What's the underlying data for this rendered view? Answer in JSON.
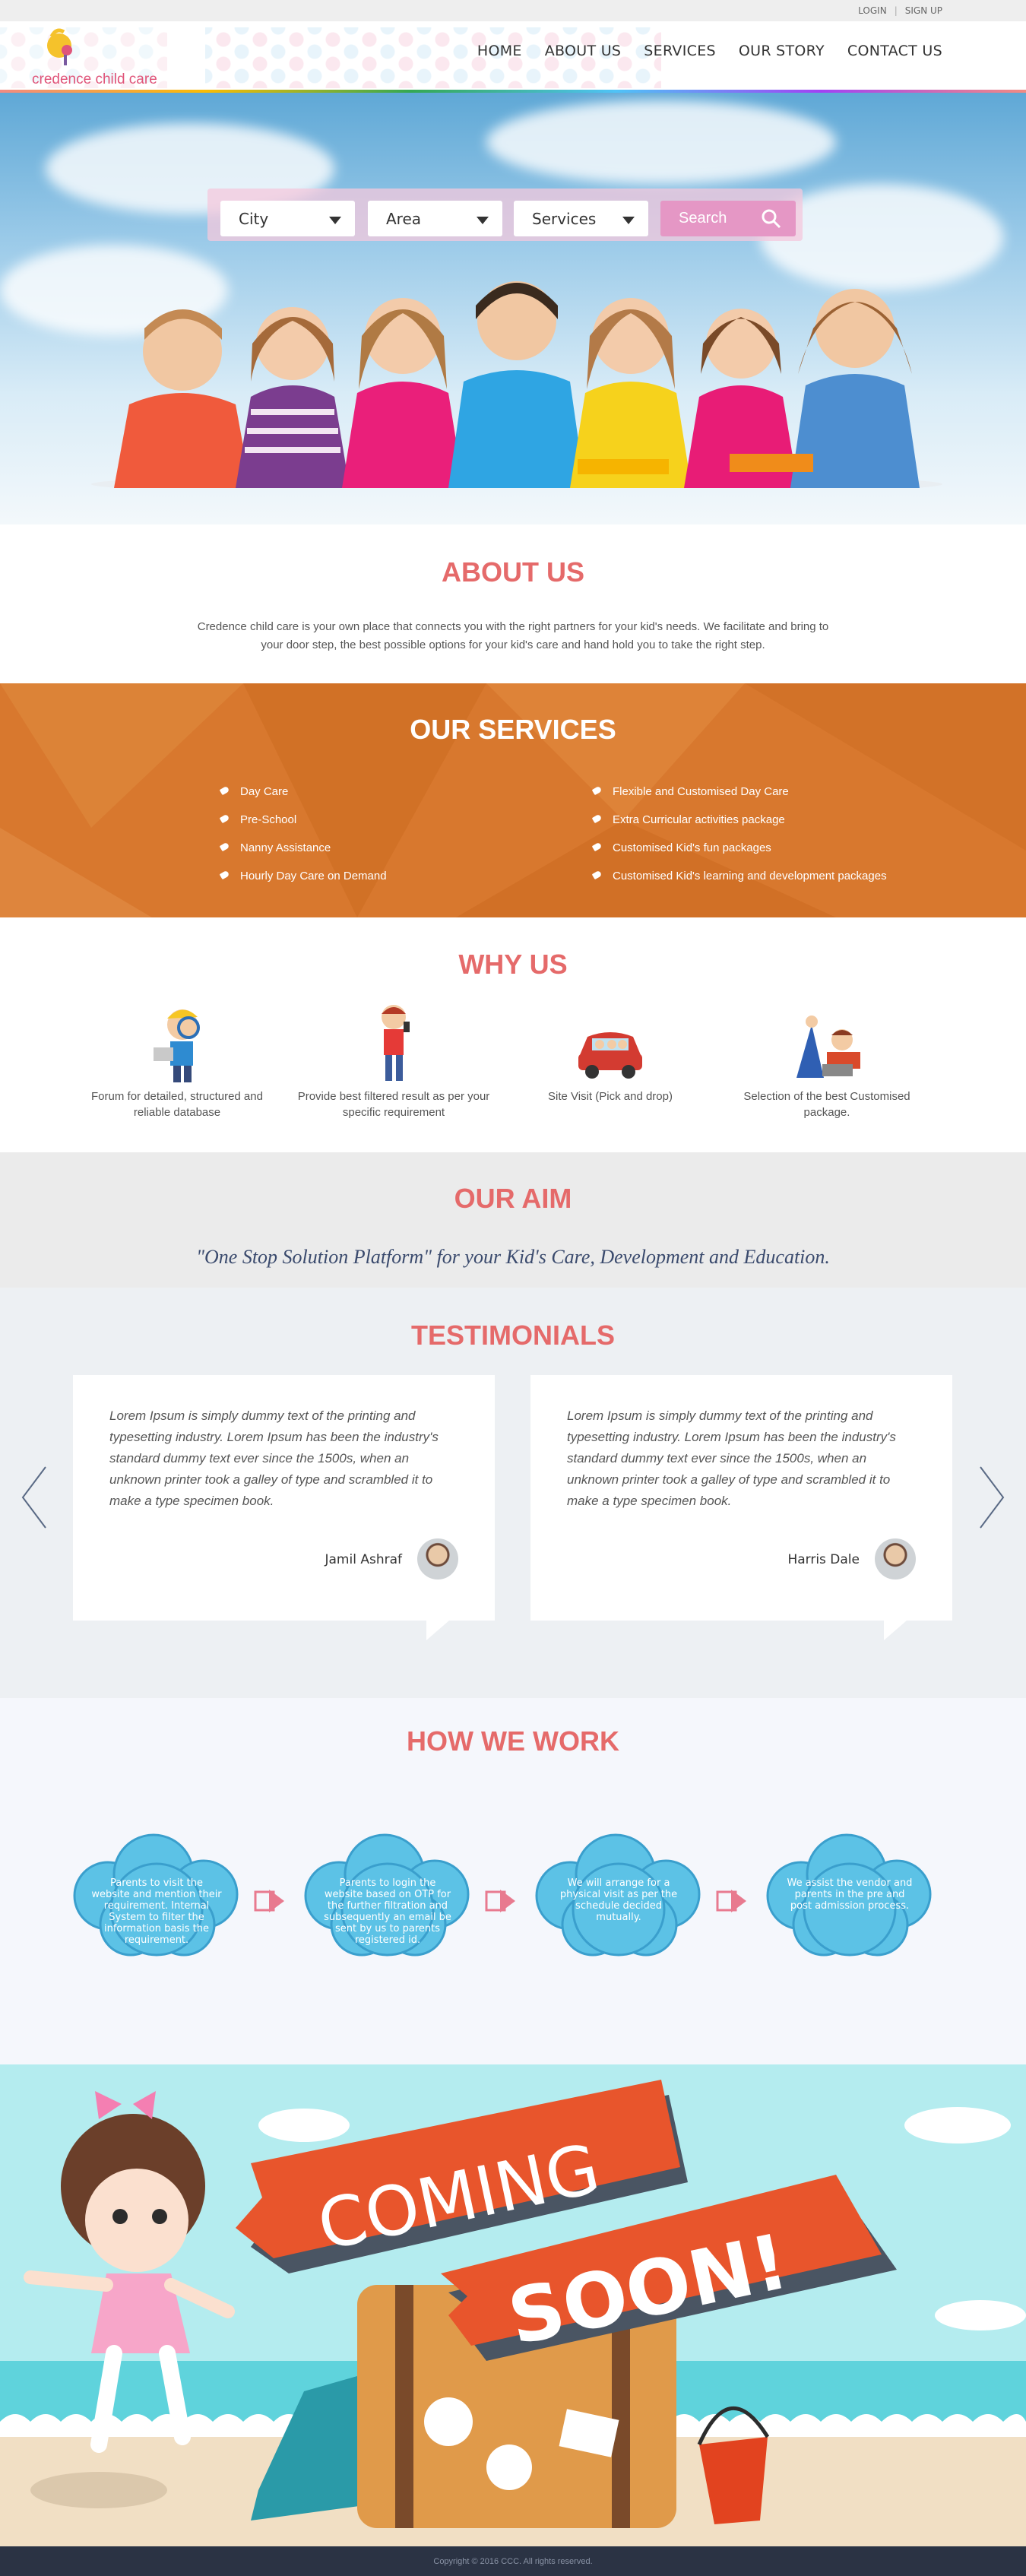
{
  "toplinks": {
    "login": "LOGIN",
    "signup": "SIGN UP"
  },
  "logo": {
    "text": "credence child care"
  },
  "nav": [
    "HOME",
    "ABOUT US",
    "SERVICES",
    "OUR STORY",
    "CONTACT US"
  ],
  "search": {
    "city": "City",
    "area": "Area",
    "services": "Services",
    "button": "Search"
  },
  "about": {
    "title": "ABOUT US",
    "text": "Credence child care is your own place that connects you with the right partners for your kid's needs. We facilitate and bring to your door step, the best possible options for your kid's care and hand hold you to take the right step."
  },
  "services": {
    "title": "OUR SERVICES",
    "left": [
      "Day Care",
      "Pre-School",
      "Nanny Assistance",
      "Hourly Day Care on Demand"
    ],
    "right": [
      "Flexible and Customised Day Care",
      "Extra Curricular activities package",
      "Customised Kid's fun packages",
      "Customised Kid's learning and development packages"
    ]
  },
  "why": {
    "title": "WHY US",
    "items": [
      "Forum for detailed, structured and reliable database",
      "Provide best filtered result as per your specific requirement",
      "Site Visit (Pick and drop)",
      "Selection of the best Customised package."
    ]
  },
  "aim": {
    "title": "OUR AIM",
    "quote": "\"One Stop Solution Platform\" for your Kid's Care, Development and Education."
  },
  "testimonials": {
    "title": "TESTIMONIALS",
    "items": [
      {
        "text": "Lorem Ipsum is simply dummy text of the printing and typesetting industry. Lorem Ipsum has been the industry's standard dummy text ever since the 1500s, when an unknown printer took a galley of type and scrambled it to make a type specimen book.",
        "name": "Jamil Ashraf"
      },
      {
        "text": "Lorem Ipsum is simply dummy text of the printing and typesetting industry. Lorem Ipsum has been the industry's standard dummy text ever since the 1500s, when an unknown printer took a galley of type and scrambled it to make a type specimen book.",
        "name": "Harris Dale"
      }
    ]
  },
  "how": {
    "title": "HOW WE WORK",
    "steps": [
      "Parents to visit the website and mention their requirement. Internal System to filter the information basis the requirement.",
      "Parents to login the website based on OTP for the further filtration and subsequently an email be sent by us to parents registered id.",
      "We will arrange for a physical visit as per the schedule decided mutually.",
      "We assist the vendor and parents in the pre and post admission process."
    ]
  },
  "coming": {
    "line1": "COMING",
    "line2": "SOON!"
  },
  "footer": {
    "copyright": "Copyright © 2016 CCC. All rights reserved."
  },
  "colors": {
    "accent": "#e56a6a",
    "services_bg": "#d8782e",
    "cloud": "#5cc2e6",
    "arrow": "#e87a8f"
  }
}
